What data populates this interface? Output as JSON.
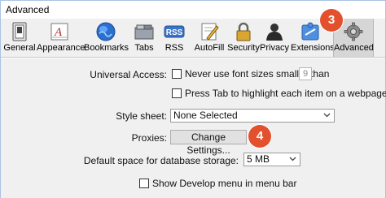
{
  "window": {
    "title": "Advanced"
  },
  "toolbar": {
    "items": [
      {
        "label": "General",
        "icon": "general-switch-icon"
      },
      {
        "label": "Appearance",
        "icon": "appearance-font-icon"
      },
      {
        "label": "Bookmarks",
        "icon": "bookmarks-globe-icon"
      },
      {
        "label": "Tabs",
        "icon": "tabs-icon"
      },
      {
        "label": "RSS",
        "icon": "rss-icon",
        "icon_text": "RSS"
      },
      {
        "label": "AutoFill",
        "icon": "autofill-pencil-icon"
      },
      {
        "label": "Security",
        "icon": "security-lock-icon"
      },
      {
        "label": "Privacy",
        "icon": "privacy-person-icon"
      },
      {
        "label": "Extensions",
        "icon": "extensions-puzzle-icon"
      },
      {
        "label": "Advanced",
        "icon": "advanced-gear-icon",
        "selected": true
      }
    ]
  },
  "form": {
    "universal_access": {
      "label": "Universal Access:",
      "font_size_checkbox": "Never use font sizes smaller than",
      "font_size_value": "9",
      "tab_checkbox": "Press Tab to highlight each item on a webpage"
    },
    "style_sheet": {
      "label": "Style sheet:",
      "value": "None Selected"
    },
    "proxies": {
      "label": "Proxies:",
      "button": "Change Settings..."
    },
    "database": {
      "label": "Default space for database storage:",
      "value": "5 MB"
    },
    "develop_menu": {
      "checkbox": "Show Develop menu in menu bar"
    }
  },
  "annotations": {
    "step3": "3",
    "step4": "4"
  },
  "colors": {
    "badge": "#e2502d",
    "selected_tab": "#d6d6d6",
    "pane_bg": "#f0f0f0"
  }
}
